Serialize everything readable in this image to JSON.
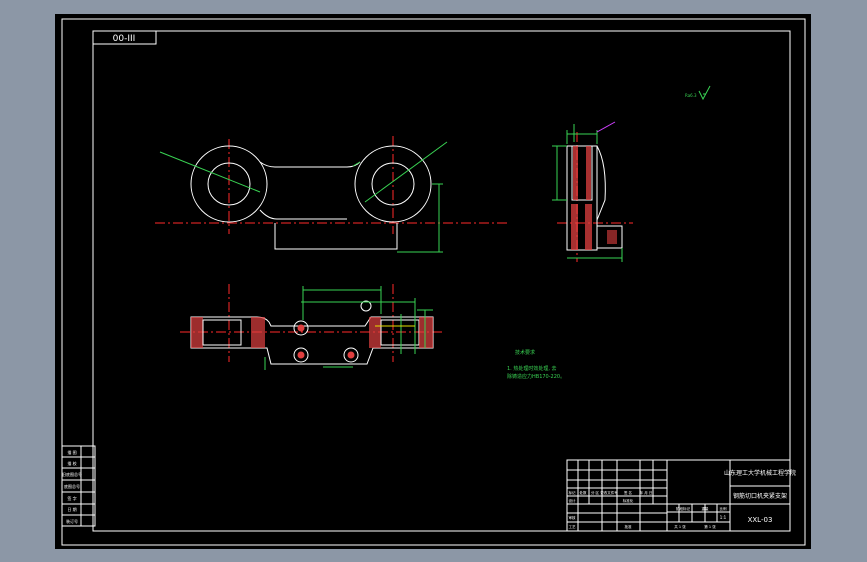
{
  "drawing": {
    "code_box": "00-III",
    "roughness_note": "Ra6.3",
    "tech_title": "技术要求",
    "tech_notes": [
      "1. 热处理时效处理, 去",
      "除铸造应力HB170-220。"
    ],
    "left_strip": [
      "描 图",
      "描 校",
      "旧底图总号",
      "底图总号",
      "签 字",
      "日 期",
      "装订号"
    ]
  },
  "title_block": {
    "school": "山东理工大学机械工程学院",
    "part_name": "钢筋切口机夹紧支架",
    "drawing_no": "XXL-03",
    "labels_row1": [
      "标记",
      "处数",
      "分 区",
      "更改文件号",
      "签 名",
      "年 月 日"
    ],
    "labels_row2": [
      "设计",
      "",
      "标准化"
    ],
    "labels_row3": [
      "审核"
    ],
    "labels_row4": [
      "工艺",
      "",
      "批准"
    ],
    "stage_label": "阶段标记",
    "weight_label": "重量",
    "scale_label": "比例",
    "scale_value": "1:1",
    "sheet_info": [
      "共 1 张",
      "第 1 张"
    ]
  },
  "colors": {
    "background": "#000000",
    "window": "#8c97a6",
    "outline": "#ffffff",
    "centerline": "#ff2a2a",
    "dimension": "#39d353",
    "hatch": "#e04040",
    "leader": "#d040ff",
    "highlight": "#e8e000"
  }
}
